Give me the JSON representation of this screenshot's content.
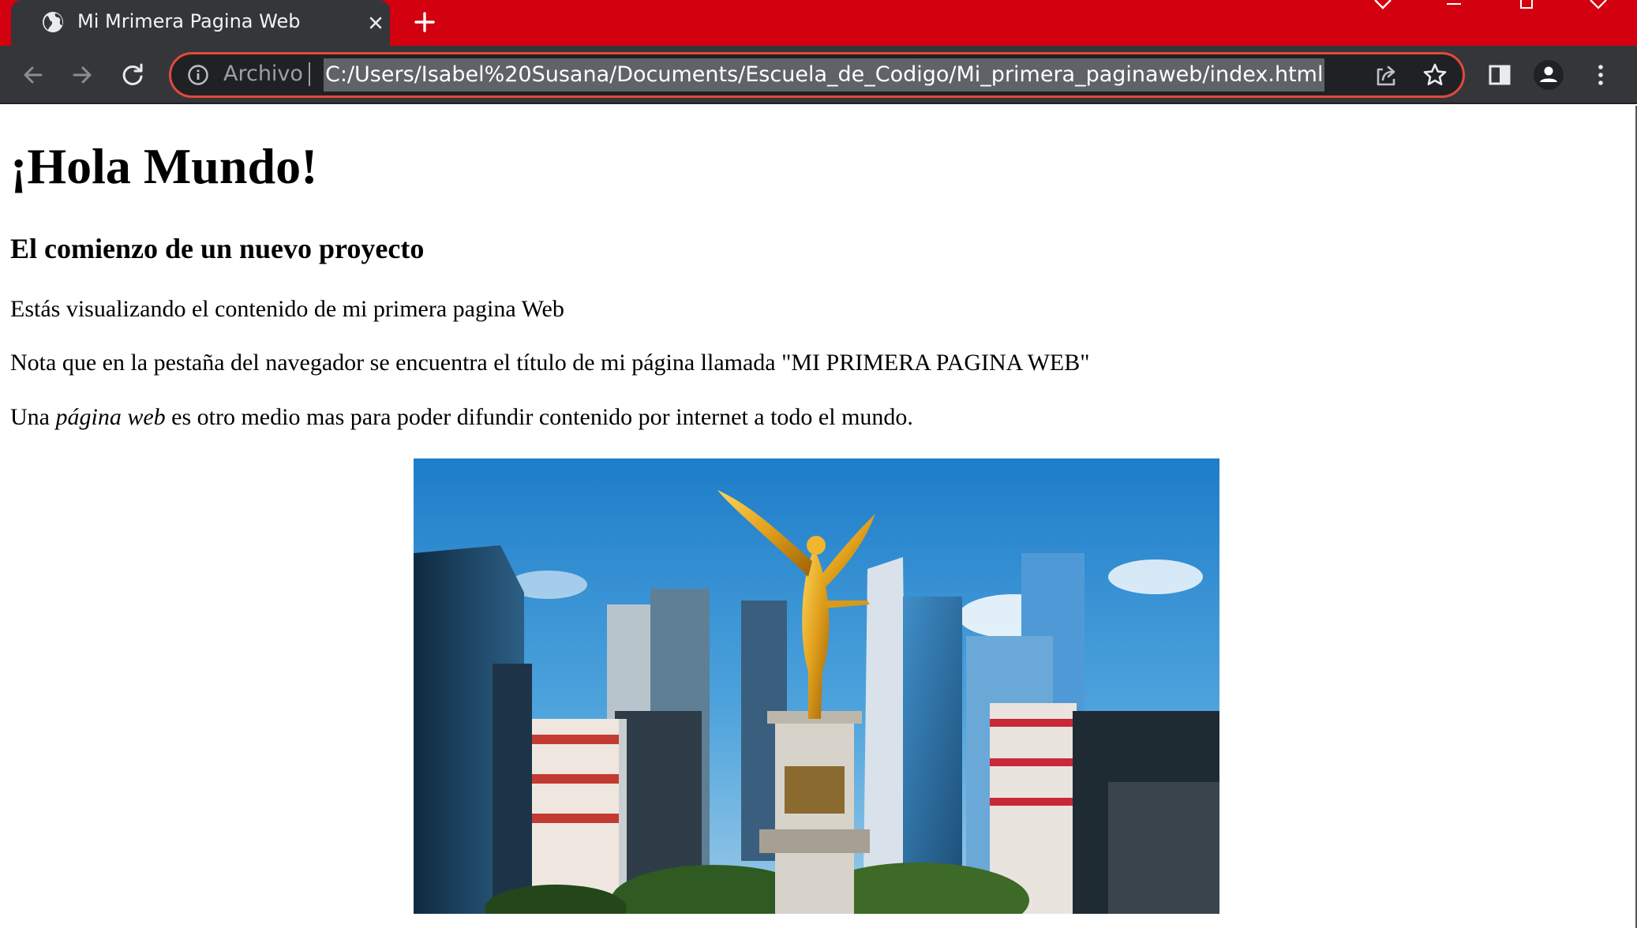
{
  "browser": {
    "tab_title": "Mi Mrimera Pagina Web",
    "omnibox_scheme": "Archivo",
    "omnibox_url": "C:/Users/Isabel%20Susana/Documents/Escuela_de_Codigo/Mi_primera_paginaweb/index.html",
    "icons": {
      "favicon": "globe-icon",
      "tab_close": "close-icon",
      "new_tab": "plus-icon",
      "back": "arrow-left-icon",
      "forward": "arrow-right-icon",
      "reload": "reload-icon",
      "info": "info-icon",
      "share": "share-icon",
      "bookmark": "star-icon",
      "side_panel": "side-panel-icon",
      "profile": "person-icon",
      "menu": "kebab-menu-icon"
    },
    "colors": {
      "frame": "#d3000f",
      "toolbar": "#35363a",
      "omnibox_border": "#e24a3b"
    }
  },
  "page": {
    "heading": "¡Hola Mundo!",
    "subheading": "El comienzo de un nuevo proyecto",
    "paragraph1": "Estás visualizando el contenido de mi primera pagina Web",
    "paragraph2": "Nota que en la pestaña del navegador se encuentra el título de mi página llamada \"MI PRIMERA PAGINA WEB\"",
    "paragraph3": {
      "before": "Una ",
      "emphasis": "página web",
      "after": " es otro medio mas para poder difundir contenido por internet a todo el mundo."
    }
  }
}
